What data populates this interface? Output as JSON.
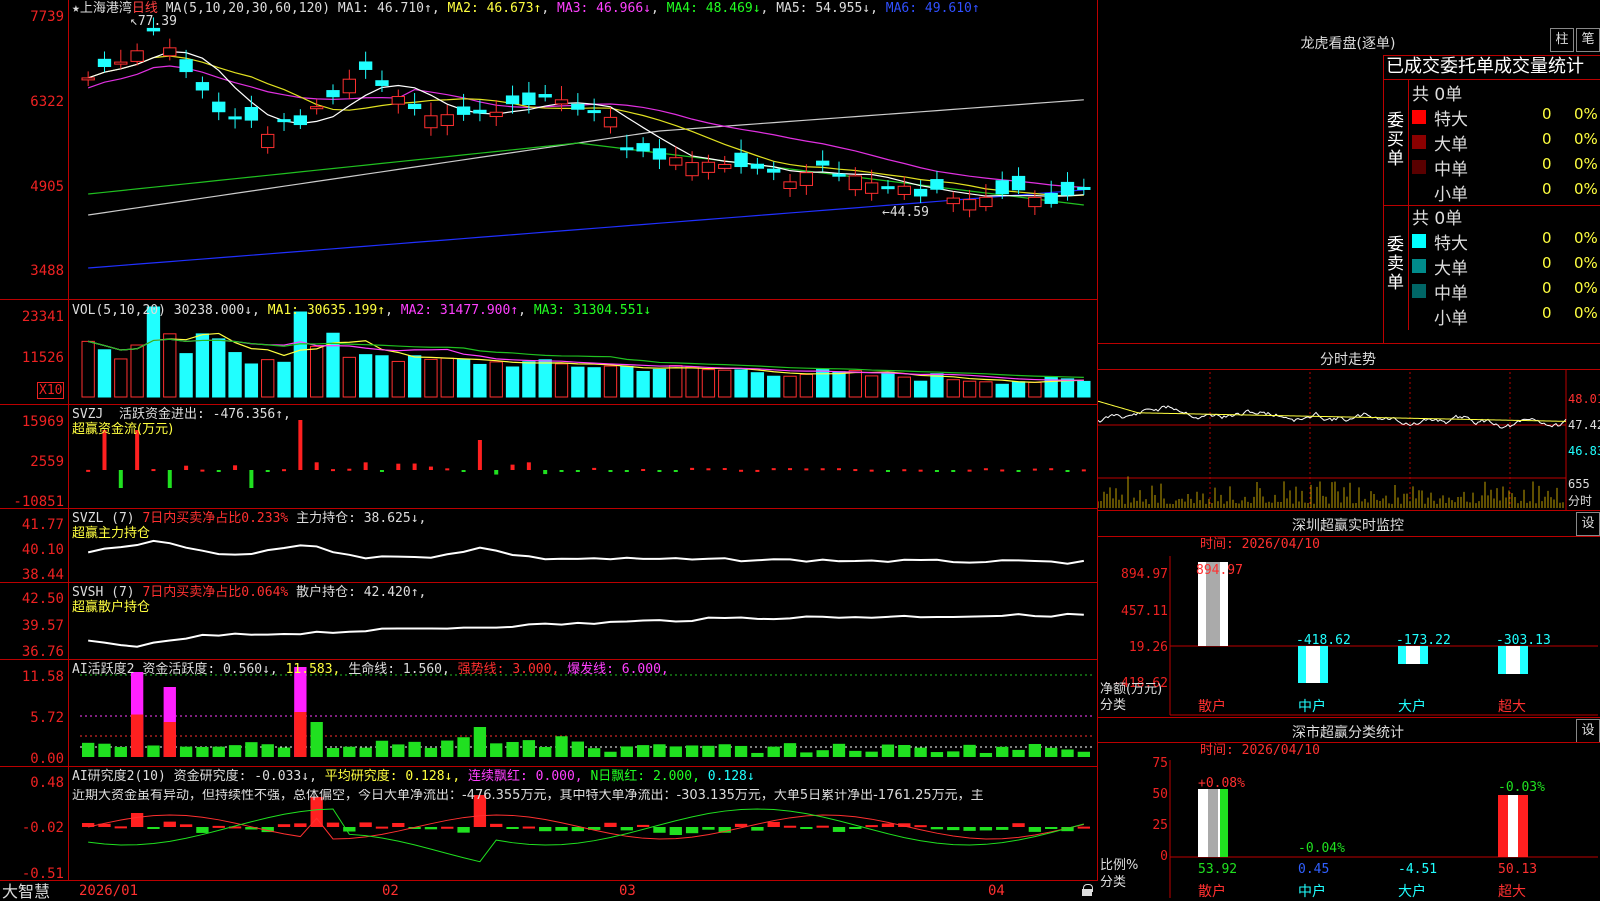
{
  "kline": {
    "stock_name": "上海港湾",
    "period": "日线",
    "ma_params": "MA(5,10,20,30,60,120)",
    "ma1": "MA1: 46.710↑",
    "ma2": "MA2: 46.673↑",
    "ma3": "MA3: 46.966↓",
    "ma4": "MA4: 48.469↓",
    "ma5": "MA5: 54.955↓",
    "ma6": "MA6: 49.610↑",
    "high_mark": "77.39",
    "low_mark": "44.59",
    "y_ticks": [
      "7739",
      "6322",
      "4905",
      "3488"
    ]
  },
  "vol": {
    "params": "VOL(5,10,20)",
    "value": "30238.000↓",
    "ma1": "MA1: 30635.199↑",
    "ma2": "MA2: 31477.900↑",
    "ma3": "MA3: 31304.551↓",
    "y_ticks": [
      "23341",
      "11526"
    ],
    "unit": "X10"
  },
  "svzj": {
    "name": "SVZJ",
    "label": "活跃资金进出: -476.356↑,",
    "sub": "超赢资金流(万元)",
    "y_ticks": [
      "15969",
      "2559",
      "-10851"
    ]
  },
  "svzl": {
    "name": "SVZL (7)",
    "label1": "7日内买卖净占比0.233%",
    "label2": "主力持仓: 38.625↓,",
    "sub": "超赢主力持仓",
    "y_ticks": [
      "41.77",
      "40.10",
      "38.44"
    ]
  },
  "svsh": {
    "name": "SVSH (7)",
    "label1": "7日内买卖净占比0.064%",
    "label2": "散户持仓: 42.420↑,",
    "sub": "超赢散户持仓",
    "y_ticks": [
      "42.50",
      "39.57",
      "36.76"
    ]
  },
  "ai1": {
    "name": "AI活跃度2",
    "a": "资金活跃度: 0.560↓,",
    "b": "11.583,",
    "c": "生命线: 1.560,",
    "d": "强势线: 3.000,",
    "e": "爆发线: 6.000,",
    "y_ticks": [
      "11.58",
      "5.72",
      "0.00"
    ]
  },
  "ai2": {
    "name": "AI研究度2(10)",
    "a": "资金研究度: -0.033↓,",
    "b": "平均研究度: 0.128↓,",
    "c": "连续飘红: 0.000,",
    "d": "N日飘红: 2.000,",
    "e": "0.128↓",
    "comment": "近期大资金虽有异动，但持续性不强，总体偏空，今日大单净流出：-476.355万元，其中特大单净流出：-303.135万元，大单5日累计净出-1761.25万元，主",
    "y_ticks": [
      "0.48",
      "-0.02",
      "-0.51"
    ]
  },
  "xaxis": {
    "brand": "大智慧",
    "labels": [
      "2026/01",
      "02",
      "03",
      "04"
    ]
  },
  "dragon": {
    "title": "龙虎看盘(逐单)",
    "btn_bar": "柱",
    "btn_pen": "笔",
    "header": "已成交委托单成交量统计",
    "buy_label": "委买单",
    "sell_label": "委卖单",
    "buy_total": "共 0单",
    "sell_total": "共 0单",
    "buy_rows": [
      {
        "name": "特大",
        "count": "0",
        "pct": "0%",
        "color": "#ff0000"
      },
      {
        "name": "大单",
        "count": "0",
        "pct": "0%",
        "color": "#8b0000"
      },
      {
        "name": "中单",
        "count": "0",
        "pct": "0%",
        "color": "#5a0000"
      },
      {
        "name": "小单",
        "count": "0",
        "pct": "0%",
        "color": "#000000"
      }
    ],
    "sell_rows": [
      {
        "name": "特大",
        "count": "0",
        "pct": "0%",
        "color": "#00ffff"
      },
      {
        "name": "大单",
        "count": "0",
        "pct": "0%",
        "color": "#008b8b"
      },
      {
        "name": "中单",
        "count": "0",
        "pct": "0%",
        "color": "#006666"
      },
      {
        "name": "小单",
        "count": "0",
        "pct": "0%",
        "color": "#000000"
      }
    ]
  },
  "intraday": {
    "title": "分时走势",
    "y_ticks": [
      "48.01",
      "47.42",
      "46.83"
    ],
    "vol_tick": "655",
    "vol_label": "分时"
  },
  "monitor": {
    "title": "深圳超赢实时监控",
    "settings": "设",
    "time": "时间: 2026/04/10",
    "y_ticks": [
      "894.97",
      "457.11",
      "19.26",
      "-418.62"
    ],
    "unit1": "净额(万元)",
    "unit2": "分类",
    "bar_labels": [
      "894.97",
      "-418.62",
      "-173.22",
      "-303.13"
    ],
    "categories": [
      "散户",
      "中户",
      "大户",
      "超大"
    ]
  },
  "classify": {
    "title": "深市超赢分类统计",
    "settings": "设",
    "time": "时间: 2026/04/10",
    "y_ticks": [
      "75",
      "50",
      "25",
      "0"
    ],
    "top_labels": [
      "+0.08%",
      "-0.04%",
      "",
      "-0.03%"
    ],
    "bottom_labels": [
      "53.92",
      "0.45",
      "-4.51",
      "50.13"
    ],
    "unit1": "比例%",
    "unit2": "分类",
    "categories": [
      "散户",
      "中户",
      "大户",
      "超大"
    ]
  }
}
